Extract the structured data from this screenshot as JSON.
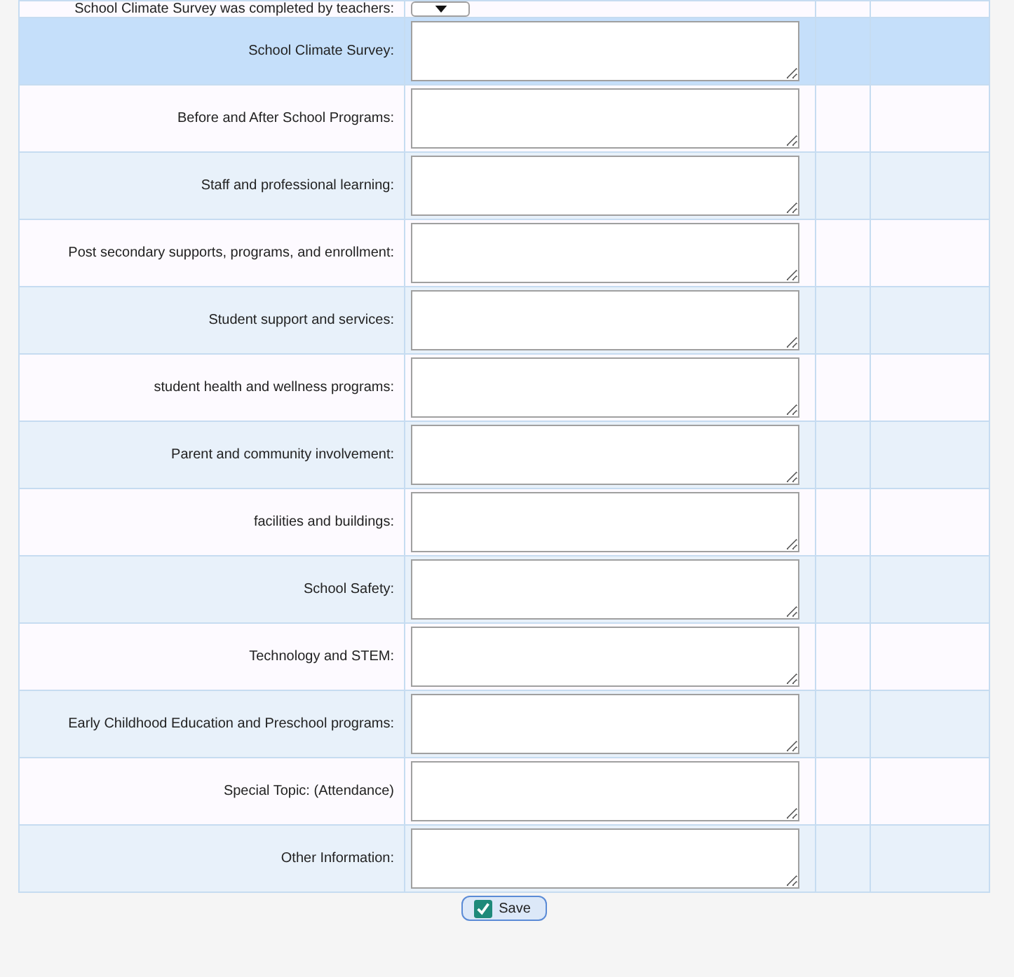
{
  "top_row": {
    "label": "School Climate Survey was completed by teachers:"
  },
  "rows": [
    {
      "label": "School Climate Survey:",
      "selected": true
    },
    {
      "label": "Before and After School Programs:",
      "selected": false
    },
    {
      "label": "Staff and professional learning:",
      "selected": false
    },
    {
      "label": "Post secondary supports, programs, and enrollment:",
      "selected": false
    },
    {
      "label": "Student support and services:",
      "selected": false
    },
    {
      "label": "student health and wellness programs:",
      "selected": false
    },
    {
      "label": "Parent and community involvement:",
      "selected": false
    },
    {
      "label": "facilities and buildings:",
      "selected": false
    },
    {
      "label": "School Safety:",
      "selected": false
    },
    {
      "label": "Technology and STEM:",
      "selected": false
    },
    {
      "label": "Early Childhood Education and Preschool programs:",
      "selected": false
    },
    {
      "label": "Special Topic: (Attendance)",
      "selected": false
    },
    {
      "label": "Other Information:",
      "selected": false
    }
  ],
  "save_button": {
    "label": "Save"
  }
}
